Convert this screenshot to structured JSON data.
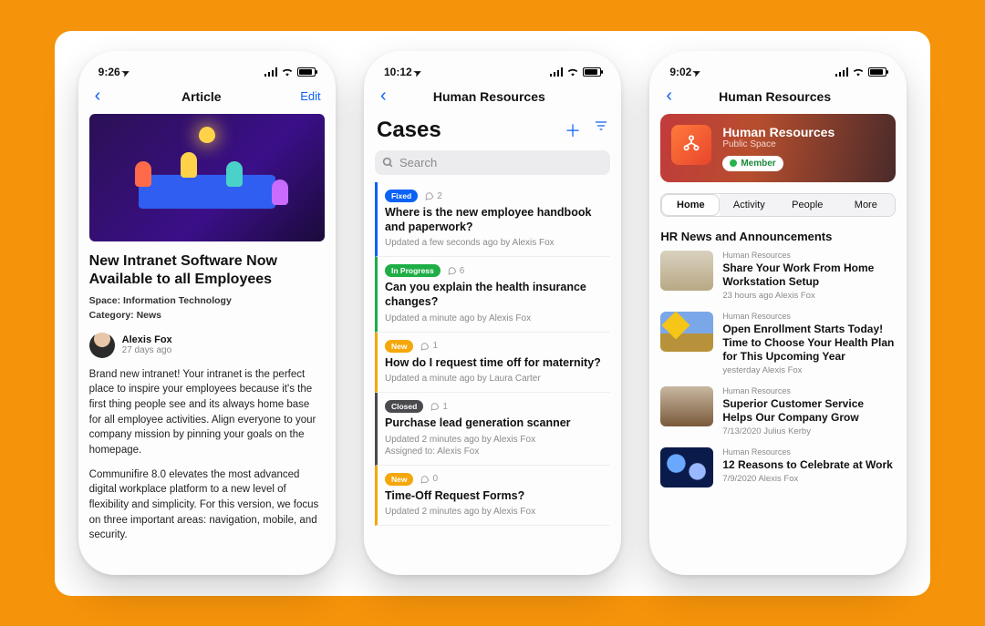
{
  "colors": {
    "fixed": "#0b62f5",
    "inprogress": "#1fae46",
    "new": "#f5a70b",
    "closed": "#4a4a4f"
  },
  "phone1": {
    "time": "9:26",
    "nav_title": "Article",
    "nav_edit": "Edit",
    "title": "New Intranet Software Now Available to all Employees",
    "space_label": "Space: Information Technology",
    "category_label": "Category: News",
    "author": "Alexis Fox",
    "author_sub": "27 days ago",
    "para1": "Brand new intranet! Your intranet is the perfect place to inspire your employees because it's the first thing people see and its always home base for all employee activities. Align everyone to your company mission by pinning your goals on the homepage.",
    "para2": "Communifire 8.0 elevates the most advanced digital workplace platform to a new level of flexibility and simplicity. For this version, we focus on three important areas: navigation, mobile, and security."
  },
  "phone2": {
    "time": "10:12",
    "nav_title": "Human Resources",
    "heading": "Cases",
    "search_placeholder": "Search",
    "cases": [
      {
        "status": "Fixed",
        "color": "#0b62f5",
        "comments": "2",
        "title": "Where is the new employee handbook and paperwork?",
        "sub": "Updated a few seconds ago by Alexis Fox"
      },
      {
        "status": "In Progress",
        "color": "#1fae46",
        "comments": "6",
        "title": "Can you explain the health insurance changes?",
        "sub": "Updated a minute ago by Alexis Fox"
      },
      {
        "status": "New",
        "color": "#f5a70b",
        "comments": "1",
        "title": "How do I request time off for maternity?",
        "sub": "Updated a minute ago by Laura Carter"
      },
      {
        "status": "Closed",
        "color": "#4a4a4f",
        "comments": "1",
        "title": "Purchase lead generation scanner",
        "sub": "Updated 2 minutes ago by Alexis Fox",
        "sub2": "Assigned to: Alexis Fox"
      },
      {
        "status": "New",
        "color": "#f5a70b",
        "comments": "0",
        "title": "Time-Off Request Forms?",
        "sub": "Updated 2 minutes ago by Alexis Fox"
      }
    ]
  },
  "phone3": {
    "time": "9:02",
    "nav_title": "Human Resources",
    "banner_title": "Human Resources",
    "banner_sub": "Public Space",
    "member": "Member",
    "tabs": [
      "Home",
      "Activity",
      "People",
      "More"
    ],
    "section": "HR News and Announcements",
    "news": [
      {
        "cat": "Human Resources",
        "title": "Share Your Work From Home Workstation Setup",
        "sub": "23 hours ago Alexis Fox"
      },
      {
        "cat": "Human Resources",
        "title": "Open Enrollment Starts Today! Time to Choose Your Health Plan for This Upcoming Year",
        "sub": "yesterday Alexis Fox"
      },
      {
        "cat": "Human Resources",
        "title": "Superior Customer Service Helps Our Company Grow",
        "sub": "7/13/2020 Julius Kerby"
      },
      {
        "cat": "Human Resources",
        "title": "12 Reasons to Celebrate at Work",
        "sub": "7/9/2020 Alexis Fox"
      }
    ]
  }
}
